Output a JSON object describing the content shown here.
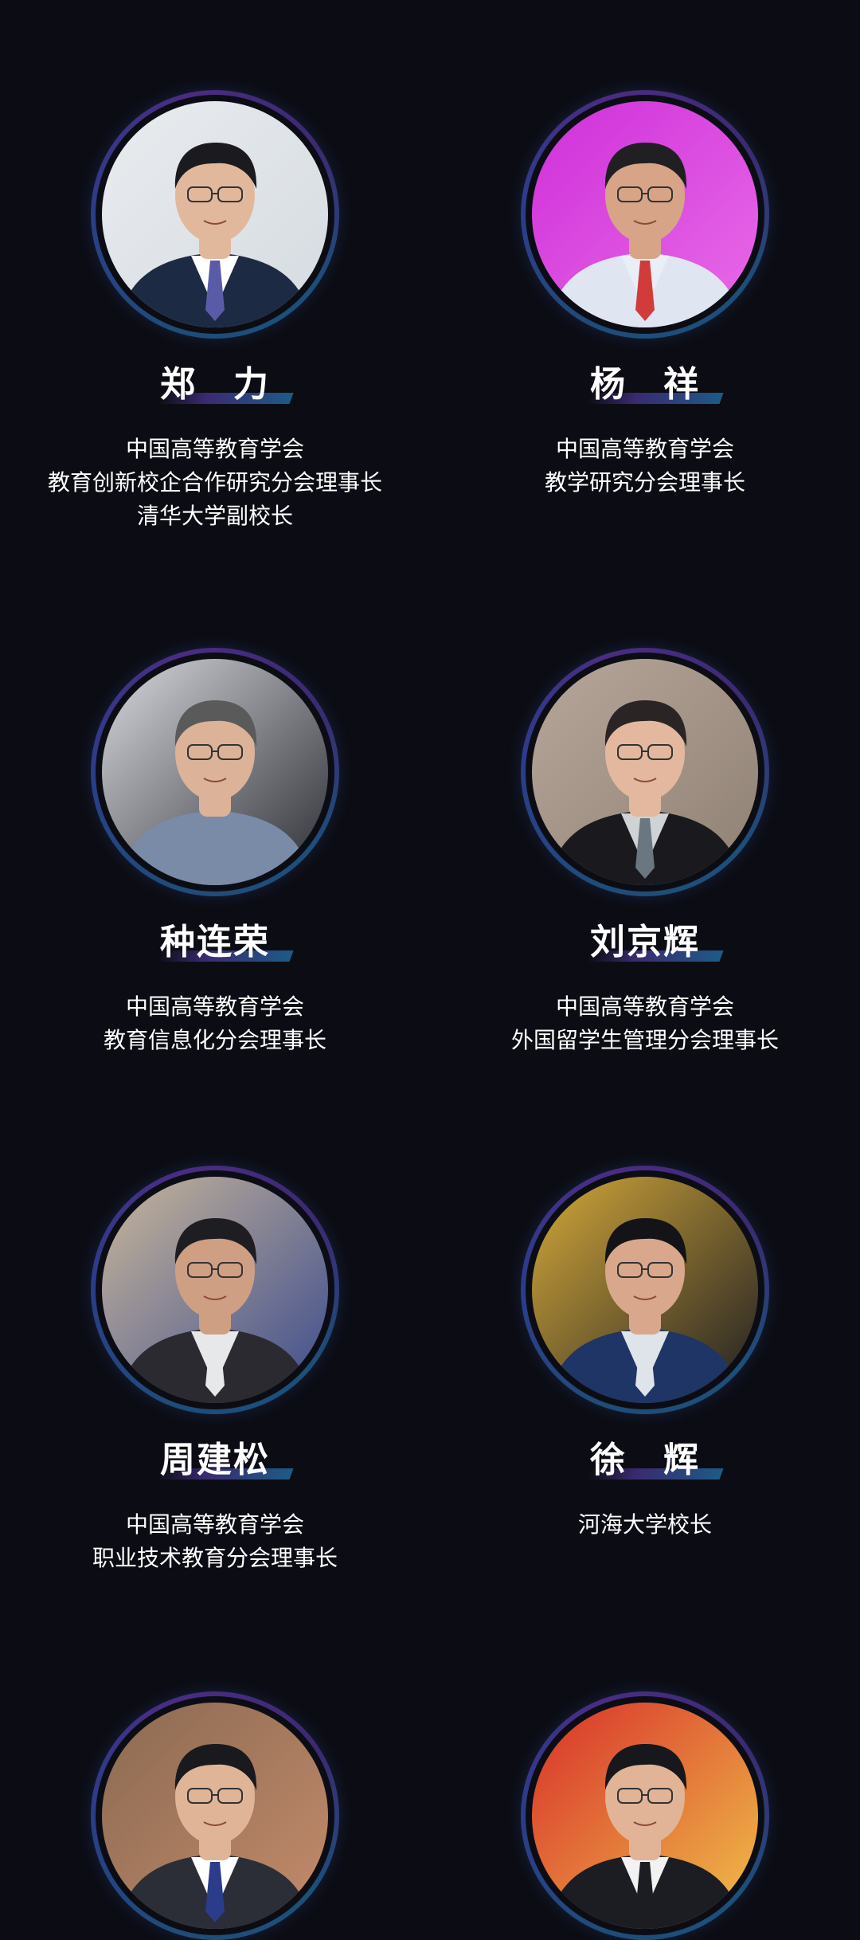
{
  "speakers": [
    {
      "name": "郑　力",
      "titles": [
        "中国高等教育学会",
        "教育创新校企合作研究分会理事长",
        "清华大学副校长"
      ],
      "photo": {
        "bg": "#e9ecef",
        "bg2": "#d5dbe1",
        "suit": "#1d2a44",
        "shirt": "#ffffff",
        "tie": "#5a5ba8",
        "skin": "#e2b89c",
        "hair": "#1b1b1f"
      }
    },
    {
      "name": "杨　祥",
      "titles": [
        "中国高等教育学会",
        "教学研究分会理事长"
      ],
      "photo": {
        "bg": "#cf2fd9",
        "bg2": "#e86ce8",
        "suit": "#dfe6f2",
        "shirt": "#e9eef7",
        "tie": "#d23b3b",
        "skin": "#d7a488",
        "hair": "#202022"
      }
    },
    {
      "name": "种连荣",
      "titles": [
        "中国高等教育学会",
        "教育信息化分会理事长"
      ],
      "photo": {
        "bg": "#d7d9dd",
        "bg2": "#2a2c33",
        "suit": "#7a8ba8",
        "shirt": "#7a8ba8",
        "tie": "#7a8ba8",
        "skin": "#dcb299",
        "hair": "#5a5a5a"
      }
    },
    {
      "name": "刘京辉",
      "titles": [
        "中国高等教育学会",
        "外国留学生管理分会理事长"
      ],
      "photo": {
        "bg": "#b7a79a",
        "bg2": "#8f8074",
        "suit": "#1a1a1e",
        "shirt": "#cfd3d6",
        "tie": "#6a7780",
        "skin": "#e3b89f",
        "hair": "#2a2524"
      }
    },
    {
      "name": "周建松",
      "titles": [
        "中国高等教育学会",
        "职业技术教育分会理事长"
      ],
      "photo": {
        "bg": "#c9b79c",
        "bg2": "#3a4a8c",
        "suit": "#2a2a30",
        "shirt": "#e6e8ea",
        "tie": "#e6e8ea",
        "skin": "#cf9f84",
        "hair": "#1e1e22"
      }
    },
    {
      "name": "徐　辉",
      "titles": [
        "河海大学校长"
      ],
      "photo": {
        "bg": "#d4a93a",
        "bg2": "#1d1d22",
        "suit": "#1f3566",
        "shirt": "#dfe3ea",
        "tie": "#dfe3ea",
        "skin": "#d9a88c",
        "hair": "#141418"
      }
    },
    {
      "name": "",
      "titles": [],
      "photo": {
        "bg": "#8a6a52",
        "bg2": "#c58b6b",
        "suit": "#2b2e36",
        "shirt": "#ffffff",
        "tie": "#2a3c8a",
        "skin": "#e0b497",
        "hair": "#1a1a1e"
      }
    },
    {
      "name": "",
      "titles": [],
      "photo": {
        "bg": "#d82f2a",
        "bg2": "#f0c24a",
        "suit": "#1c1d22",
        "shirt": "#f2f2f2",
        "tie": "#1c1d22",
        "skin": "#e1b497",
        "hair": "#18181c"
      }
    }
  ]
}
